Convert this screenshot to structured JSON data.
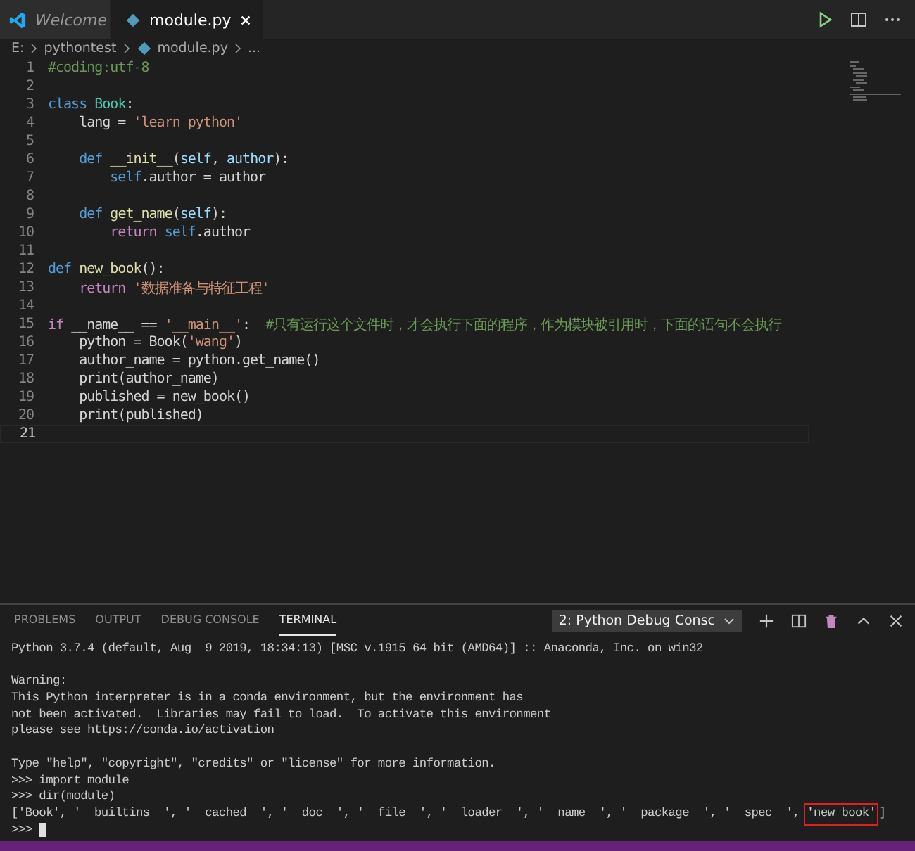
{
  "tabs": [
    {
      "label": "Welcome",
      "selected": false
    },
    {
      "label": "module.py",
      "selected": true
    }
  ],
  "breadcrumb": {
    "drive": "E:",
    "folder": "pythontest",
    "file": "module.py",
    "more": "..."
  },
  "editor": {
    "lines": [
      {
        "number": "1",
        "current": false,
        "tokens": [
          {
            "kind": "comment",
            "text": "#coding:utf-8"
          }
        ]
      },
      {
        "number": "2",
        "current": false
      },
      {
        "number": "3",
        "current": false,
        "tokens": [
          {
            "kind": "keyword",
            "text": "class"
          },
          {
            "kind": "class",
            "text": " Book"
          },
          {
            "kind": "plain",
            "text": ":"
          }
        ]
      },
      {
        "number": "4",
        "current": false,
        "tokens": [
          {
            "kind": "plain",
            "text": "    lang = "
          },
          {
            "kind": "string",
            "text": "'learn python'"
          }
        ]
      },
      {
        "number": "5",
        "current": false
      },
      {
        "number": "6",
        "current": false,
        "tokens": [
          {
            "kind": "keyword",
            "text": "    def"
          },
          {
            "kind": "func",
            "text": " __init__"
          },
          {
            "kind": "plain",
            "text": "("
          },
          {
            "kind": "param",
            "text": "self"
          },
          {
            "kind": "plain",
            "text": ", "
          },
          {
            "kind": "param",
            "text": "author"
          },
          {
            "kind": "plain",
            "text": "):"
          }
        ]
      },
      {
        "number": "7",
        "current": false,
        "tokens": [
          {
            "kind": "keyword",
            "text": "        self"
          },
          {
            "kind": "plain",
            "text": ".author = author"
          }
        ]
      },
      {
        "number": "8",
        "current": false
      },
      {
        "number": "9",
        "current": false,
        "tokens": [
          {
            "kind": "keyword",
            "text": "    def"
          },
          {
            "kind": "func",
            "text": " get_name"
          },
          {
            "kind": "plain",
            "text": "("
          },
          {
            "kind": "param",
            "text": "self"
          },
          {
            "kind": "plain",
            "text": "):"
          }
        ]
      },
      {
        "number": "10",
        "current": false,
        "tokens": [
          {
            "kind": "control",
            "text": "        return"
          },
          {
            "kind": "keyword",
            "text": " self"
          },
          {
            "kind": "plain",
            "text": ".author"
          }
        ]
      },
      {
        "number": "11",
        "current": false
      },
      {
        "number": "12",
        "current": false,
        "tokens": [
          {
            "kind": "keyword",
            "text": "def"
          },
          {
            "kind": "func",
            "text": " new_book"
          },
          {
            "kind": "plain",
            "text": "():"
          }
        ]
      },
      {
        "number": "13",
        "current": false,
        "tokens": [
          {
            "kind": "control",
            "text": "    return"
          },
          {
            "kind": "string",
            "text": " '数据准备与特征工程'"
          }
        ]
      },
      {
        "number": "14",
        "current": false
      },
      {
        "number": "15",
        "current": false,
        "tokens": [
          {
            "kind": "control",
            "text": "if"
          },
          {
            "kind": "plain",
            "text": " __name__ == "
          },
          {
            "kind": "string",
            "text": "'__main__'"
          },
          {
            "kind": "plain",
            "text": ":  "
          },
          {
            "kind": "comment",
            "text": "#只有运行这个文件时，才会执行下面的程序，作为模块被引用时，下面的语句不会执行"
          }
        ]
      },
      {
        "number": "16",
        "current": false,
        "tokens": [
          {
            "kind": "plain",
            "text": "    python = Book("
          },
          {
            "kind": "string",
            "text": "'wang'"
          },
          {
            "kind": "plain",
            "text": ")"
          }
        ]
      },
      {
        "number": "17",
        "current": false,
        "tokens": [
          {
            "kind": "plain",
            "text": "    author_name = python.get_name()"
          }
        ]
      },
      {
        "number": "18",
        "current": false,
        "tokens": [
          {
            "kind": "plain",
            "text": "    print(author_name)"
          }
        ]
      },
      {
        "number": "19",
        "current": false,
        "tokens": [
          {
            "kind": "plain",
            "text": "    published = new_book()"
          }
        ]
      },
      {
        "number": "20",
        "current": false,
        "tokens": [
          {
            "kind": "plain",
            "text": "    print(published)"
          }
        ]
      },
      {
        "number": "21",
        "current": true
      }
    ]
  },
  "panel": {
    "tabs": [
      {
        "label": "PROBLEMS",
        "selected": false
      },
      {
        "label": "OUTPUT",
        "selected": false
      },
      {
        "label": "DEBUG CONSOLE",
        "selected": false
      },
      {
        "label": "TERMINAL",
        "selected": true
      }
    ],
    "terminal_select": "2: Python Debug Consc",
    "terminal_cursor": true,
    "terminal": [
      {
        "lines": [
          {
            "text": "Python 3.7.4 (default, Aug  9 2019, 18:34:13) [MSC v.1915 64 bit (AMD64)] :: Anaconda, Inc. on win32"
          }
        ]
      },
      {
        "lines": [
          {
            "text": "Warning:"
          },
          {
            "text": "This Python interpreter is in a conda environment, but the environment has"
          },
          {
            "text": "not been activated.  Libraries may fail to load.  To activate this environment"
          },
          {
            "text": "please see https://conda.io/activation"
          }
        ]
      },
      {
        "lines": [
          {
            "text": "Type \"help\", \"copyright\", \"credits\" or \"license\" for more information."
          },
          {
            "text": ">>> import module"
          },
          {
            "text": ">>> dir(module)"
          },
          {
            "text": "['Book', '__builtins__', '__cached__', '__doc__', '__file__', '__loader__', '__name__', '__package__', '__spec__',",
            "highlight": "'new_book'",
            "after": "]"
          },
          {
            "text": ">>>"
          }
        ]
      }
    ]
  }
}
